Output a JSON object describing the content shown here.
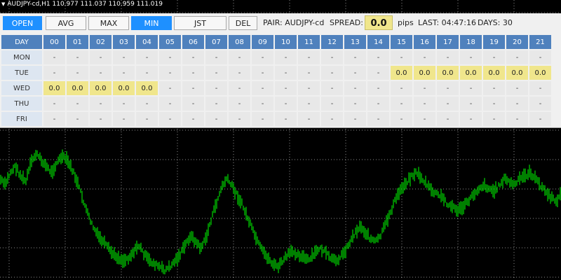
{
  "chart": {
    "symbol_line": "AUDJPY-cd,H1  110.977 111.037 110.959 111.019",
    "background": "#000000",
    "candle_color": "#00ff00",
    "grid_color": "#ffffff",
    "price_path": [
      0.62,
      0.58,
      0.66,
      0.7,
      0.64,
      0.6,
      0.72,
      0.78,
      0.74,
      0.7,
      0.66,
      0.72,
      0.76,
      0.74,
      0.68,
      0.6,
      0.5,
      0.4,
      0.32,
      0.26,
      0.22,
      0.18,
      0.14,
      0.12,
      0.1,
      0.12,
      0.16,
      0.2,
      0.14,
      0.1,
      0.08,
      0.06,
      0.04,
      0.06,
      0.1,
      0.14,
      0.2,
      0.26,
      0.22,
      0.18,
      0.24,
      0.36,
      0.46,
      0.56,
      0.62,
      0.58,
      0.52,
      0.46,
      0.38,
      0.3,
      0.22,
      0.16,
      0.12,
      0.08,
      0.06,
      0.1,
      0.14,
      0.16,
      0.14,
      0.12,
      0.1,
      0.14,
      0.18,
      0.16,
      0.12,
      0.1,
      0.12,
      0.16,
      0.22,
      0.28,
      0.32,
      0.28,
      0.24,
      0.22,
      0.26,
      0.34,
      0.42,
      0.5,
      0.56,
      0.6,
      0.64,
      0.66,
      0.62,
      0.58,
      0.54,
      0.52,
      0.5,
      0.46,
      0.44,
      0.42,
      0.44,
      0.48,
      0.52,
      0.56,
      0.58,
      0.56,
      0.54,
      0.58,
      0.62,
      0.6,
      0.58,
      0.62,
      0.64,
      0.66,
      0.62,
      0.58,
      0.54,
      0.5,
      0.48,
      0.52
    ]
  },
  "toolbar": {
    "buttons": [
      {
        "label": "OPEN",
        "active": true
      },
      {
        "label": "AVG",
        "active": false
      },
      {
        "label": "MAX",
        "active": false
      },
      {
        "label": "MIN",
        "active": true
      },
      {
        "label": "JST",
        "active": false
      },
      {
        "label": "DEL",
        "active": false
      }
    ],
    "pair_label": "PAIR: AUDJPY-cd",
    "spread_label": "SPREAD:",
    "spread_value": "0.0",
    "spread_unit": "pips",
    "last_label": "LAST: 04:47:16",
    "days_label": "DAYS: 30"
  },
  "table": {
    "corner": "DAY",
    "hours": [
      "00",
      "01",
      "02",
      "03",
      "04",
      "05",
      "06",
      "07",
      "08",
      "09",
      "10",
      "11",
      "12",
      "13",
      "14",
      "15",
      "16",
      "17",
      "18",
      "19",
      "20",
      "21"
    ],
    "rows": [
      {
        "day": "MON",
        "cells": [
          "-",
          "-",
          "-",
          "-",
          "-",
          "-",
          "-",
          "-",
          "-",
          "-",
          "-",
          "-",
          "-",
          "-",
          "-",
          "-",
          "-",
          "-",
          "-",
          "-",
          "-",
          "-"
        ]
      },
      {
        "day": "TUE",
        "cells": [
          "-",
          "-",
          "-",
          "-",
          "-",
          "-",
          "-",
          "-",
          "-",
          "-",
          "-",
          "-",
          "-",
          "-",
          "-",
          "0.0",
          "0.0",
          "0.0",
          "0.0",
          "0.0",
          "0.0",
          "0.0"
        ]
      },
      {
        "day": "WED",
        "cells": [
          "0.0",
          "0.0",
          "0.0",
          "0.0",
          "0.0",
          "-",
          "-",
          "-",
          "-",
          "-",
          "-",
          "-",
          "-",
          "-",
          "-",
          "-",
          "-",
          "-",
          "-",
          "-",
          "-",
          "-"
        ]
      },
      {
        "day": "THU",
        "cells": [
          "-",
          "-",
          "-",
          "-",
          "-",
          "-",
          "-",
          "-",
          "-",
          "-",
          "-",
          "-",
          "-",
          "-",
          "-",
          "-",
          "-",
          "-",
          "-",
          "-",
          "-",
          "-"
        ]
      },
      {
        "day": "FRI",
        "cells": [
          "-",
          "-",
          "-",
          "-",
          "-",
          "-",
          "-",
          "-",
          "-",
          "-",
          "-",
          "-",
          "-",
          "-",
          "-",
          "-",
          "-",
          "-",
          "-",
          "-",
          "-",
          "-"
        ]
      }
    ],
    "highlight_color": "#f0e68c"
  }
}
